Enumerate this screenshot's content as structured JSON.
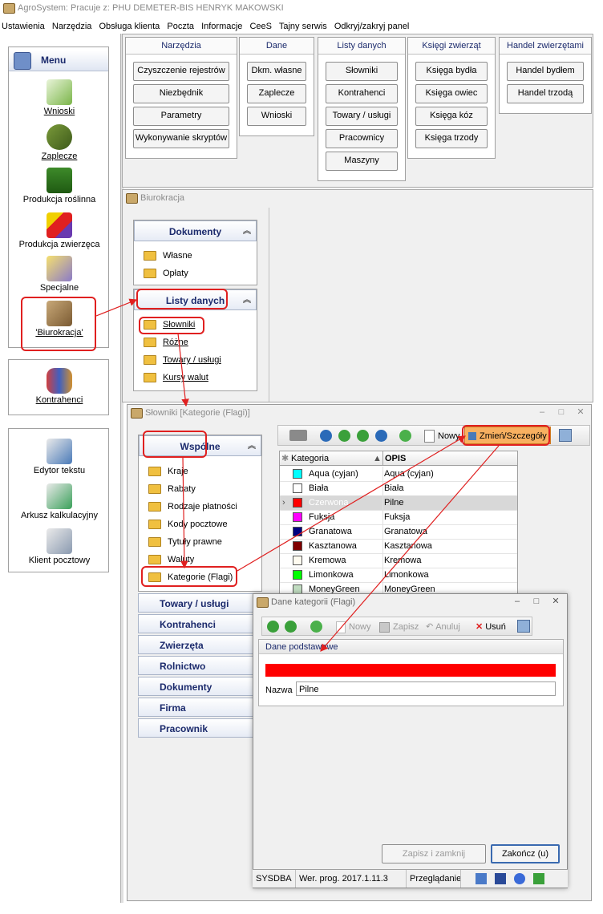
{
  "app": {
    "title": "AgroSystem: Pracuje z: PHU DEMETER-BIS HENRYK MAKOWSKI",
    "menu": [
      "Ustawienia",
      "Narzędzia",
      "Obsługa klienta",
      "Poczta",
      "Informacje",
      "CeeS",
      "Tajny serwis",
      "Odkryj/zakryj panel"
    ]
  },
  "sidebar": {
    "header": "Menu",
    "items": [
      "Wnioski",
      "Zaplecze",
      "Produkcja roślinna",
      "Produkcja zwierzęca",
      "Specjalne",
      "'Biurokracja'"
    ],
    "contacts": "Kontrahenci",
    "tools": [
      "Edytor tekstu",
      "Arkusz kalkulacyjny",
      "Klient pocztowy"
    ]
  },
  "toolbar_groups": {
    "narzedzia": {
      "title": "Narzędzia",
      "buttons": [
        "Czyszczenie rejestrów",
        "Niezbędnik",
        "Parametry",
        "Wykonywanie skryptów"
      ]
    },
    "dane": {
      "title": "Dane",
      "buttons": [
        "Dkm. własne",
        "Zaplecze",
        "Wnioski"
      ]
    },
    "listy": {
      "title": "Listy danych",
      "buttons": [
        "Słowniki",
        "Kontrahenci",
        "Towary / usługi",
        "Pracownicy",
        "Maszyny"
      ]
    },
    "ksiegi": {
      "title": "Księgi zwierząt",
      "buttons": [
        "Księga bydła",
        "Księga owiec",
        "Księga kóz",
        "Księga trzody"
      ]
    },
    "handel": {
      "title": "Handel zwierzętami",
      "buttons": [
        "Handel bydłem",
        "Handel trzodą"
      ]
    }
  },
  "biurokracja": {
    "title": "Biurokracja",
    "dokumenty": {
      "title": "Dokumenty",
      "items": [
        "Własne",
        "Opłaty"
      ]
    },
    "listy": {
      "title": "Listy danych",
      "items": [
        "Słowniki",
        "Różne",
        "Towary / usługi",
        "Kursy walut"
      ]
    }
  },
  "slowniki": {
    "title": "Słowniki [Kategorie (Flagi)]",
    "wspolne": {
      "title": "Wspólne",
      "items": [
        "Kraje",
        "Rabaty",
        "Rodzaje płatności",
        "Kody pocztowe",
        "Tytuły prawne",
        "Waluty",
        "Kategorie (Flagi)"
      ]
    },
    "sections": [
      "Towary / usługi",
      "Kontrahenci",
      "Zwierzęta",
      "Rolnictwo",
      "Dokumenty",
      "Firma",
      "Pracownik"
    ],
    "toolbar": {
      "new": "Nowy",
      "edit": "Zmień/Szczegóły"
    },
    "grid": {
      "col1": "Kategoria",
      "col2": "OPIS",
      "rows": [
        {
          "name": "Aqua (cyjan)",
          "opis": "Aqua (cyjan)",
          "color": "#00ffff"
        },
        {
          "name": "Biała",
          "opis": "Biała",
          "color": "#ffffff"
        },
        {
          "name": "Czerwona",
          "opis": "Pilne",
          "color": "#ff0000"
        },
        {
          "name": "Fuksja",
          "opis": "Fuksja",
          "color": "#ff00ff"
        },
        {
          "name": "Granatowa",
          "opis": "Granatowa",
          "color": "#000080"
        },
        {
          "name": "Kasztanowa",
          "opis": "Kasztanowa",
          "color": "#800000"
        },
        {
          "name": "Kremowa",
          "opis": "Kremowa",
          "color": "#fffbf0"
        },
        {
          "name": "Limonkowa",
          "opis": "Limonkowa",
          "color": "#00ff00"
        },
        {
          "name": "MoneyGreen",
          "opis": "MoneyGreen",
          "color": "#c0dcc0"
        }
      ]
    }
  },
  "dialog": {
    "title": "Dane kategorii (Flagi)",
    "toolbar": {
      "new": "Nowy",
      "save": "Zapisz",
      "cancel": "Anuluj",
      "delete": "Usuń"
    },
    "section": "Dane podstawowe",
    "color": "#ff0000",
    "name_label": "Nazwa",
    "name_value": "Pilne",
    "save_close": "Zapisz i zamknij",
    "close": "Zakończ (u)"
  },
  "status": {
    "user": "SYSDBA",
    "version": "Wer. prog. 2017.1.11.3",
    "mode": "Przeglądanie"
  }
}
